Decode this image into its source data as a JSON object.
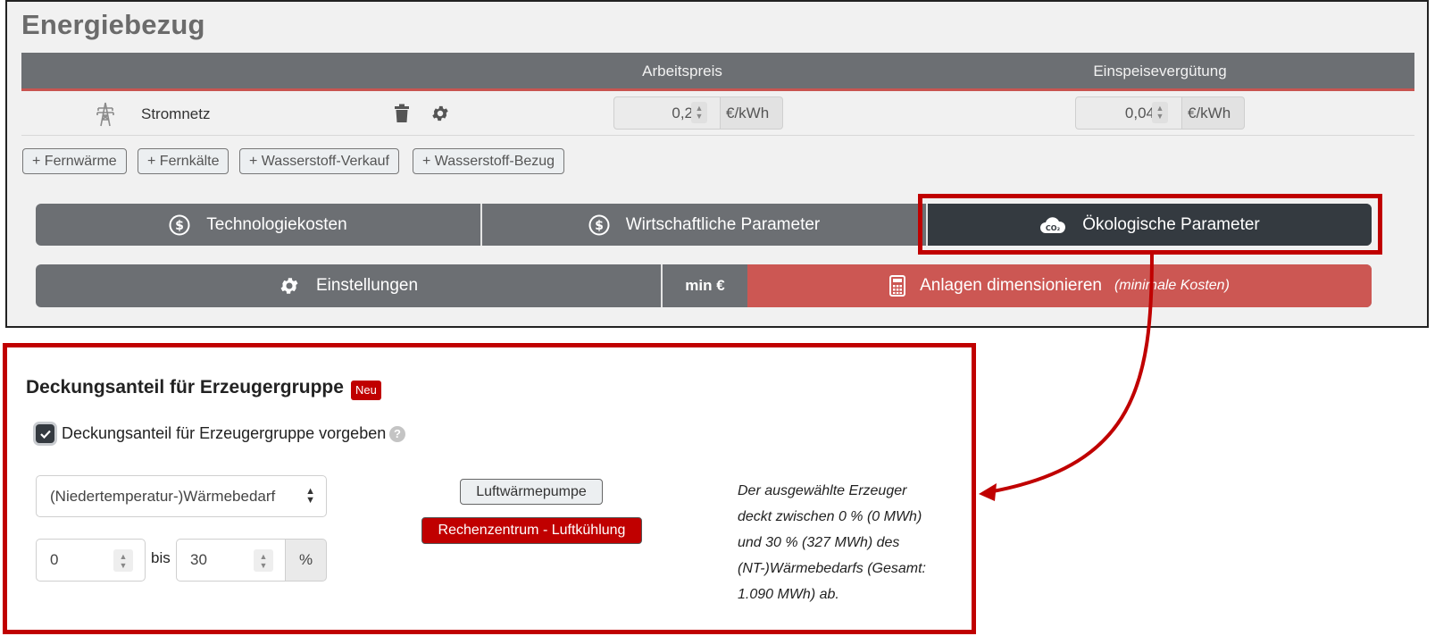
{
  "section": {
    "title": "Energiebezug",
    "columns": [
      "Arbeitspreis",
      "Einspeisevergütung"
    ]
  },
  "source_row": {
    "icon": "power-pylon-icon",
    "name": "Stromnetz",
    "arbeitspreis": {
      "value": "0,2",
      "unit": "€/kWh"
    },
    "einspeise": {
      "value": "0,04",
      "unit": "€/kWh"
    }
  },
  "add_buttons": [
    "+ Fernwärme",
    "+ Fernkälte",
    "+ Wasserstoff-Verkauf",
    "+ Wasserstoff-Bezug"
  ],
  "tabs": [
    {
      "label": "Technologiekosten",
      "icon": "dollar-circle-icon",
      "active": false
    },
    {
      "label": "Wirtschaftliche Parameter",
      "icon": "dollar-circle-icon",
      "active": true
    },
    {
      "label": "Ökologische Parameter",
      "icon": "co2-cloud-icon",
      "active": true
    }
  ],
  "actions": {
    "settings_label": "Einstellungen",
    "mode_label": "min €",
    "dimension_label": "Anlagen dimensionieren",
    "dimension_note": "(minimale Kosten)"
  },
  "coverage": {
    "title": "Deckungsanteil für Erzeugergruppe",
    "badge": "Neu",
    "checkbox_label": "Deckungsanteil für Erzeugergruppe vorgeben",
    "checked": true,
    "help_glyph": "?",
    "select_value": "(Niedertemperatur-)Wärmebedarf",
    "min": "0",
    "bis_label": "bis",
    "max": "30",
    "unit": "%",
    "generators": [
      "Luftwärmepumpe",
      "Rechenzentrum - Luftkühlung"
    ],
    "info_lines": [
      "Der ausgewählte Erzeuger",
      "deckt zwischen 0 % (0 MWh)",
      "und 30 % (327 MWh) des",
      "(NT-)Wärmebedarfs (Gesamt:",
      "1.090 MWh) ab."
    ]
  },
  "colors": {
    "highlight": "#c00000",
    "header_gray": "#6c6f73",
    "active_tab": "#343a40",
    "dimension_red": "#cc5753"
  }
}
